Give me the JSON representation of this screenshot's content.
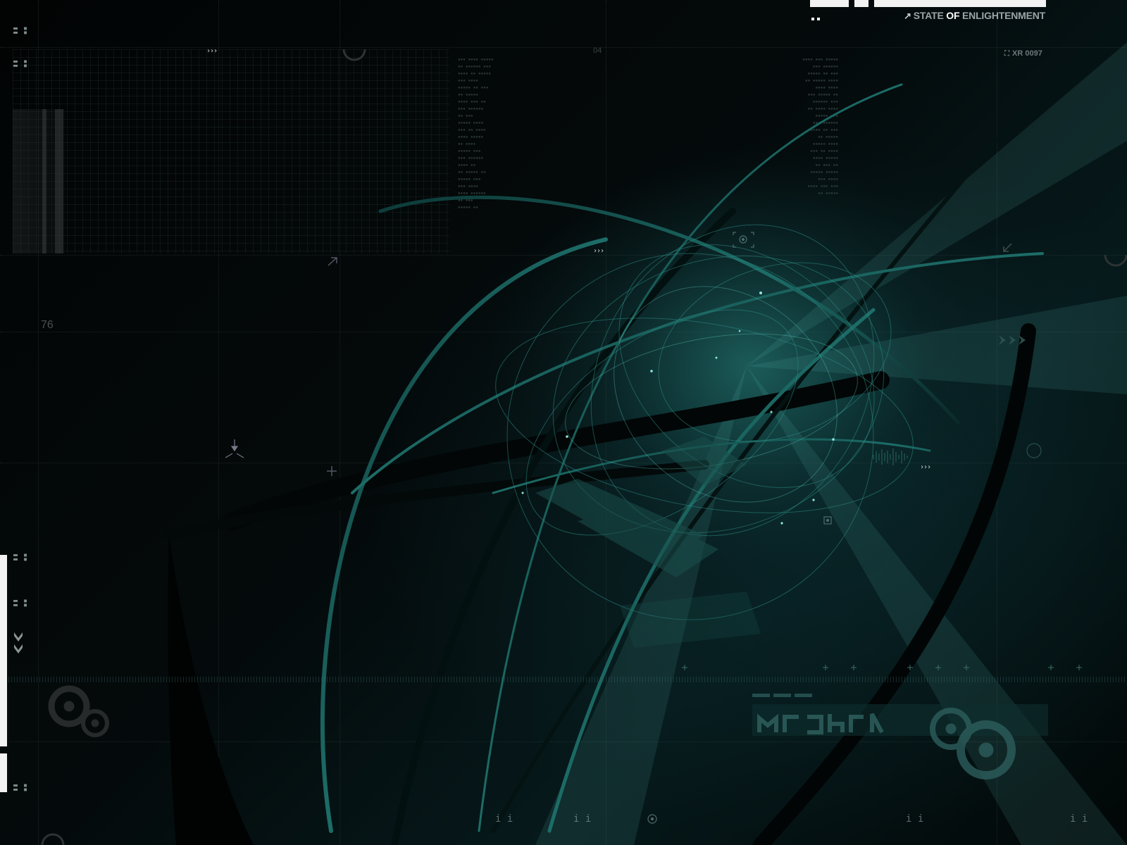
{
  "brand": {
    "arrow_glyph": "↗",
    "state": "STATE ",
    "of": "OF",
    "enlightenment": " ENLIGHTENMENT"
  },
  "labels": {
    "code": "XR 0097",
    "number_top": "04",
    "number_left": "76",
    "chevrons": "›››",
    "ii": "i i"
  },
  "colors": {
    "accent_teal": "#1c6e6a",
    "bright_teal": "#3aa79f",
    "bar_white": "#f2f2f2"
  },
  "icons": {
    "corner_icon": "corner-bracket-icon",
    "target_icon": "target-reticle-icon",
    "arrow_icon": "diagonal-arrow-icon",
    "chevron_down_icon": "double-chevron-down-icon"
  }
}
